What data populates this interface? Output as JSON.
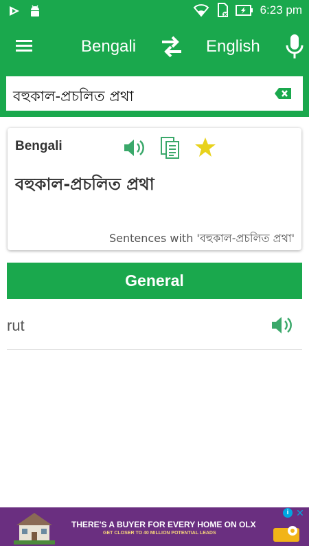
{
  "status_bar": {
    "time": "6:23 pm"
  },
  "app_bar": {
    "source_language": "Bengali",
    "target_language": "English",
    "icons": [
      "hamburger-menu-icon",
      "swap-arrows-icon",
      "microphone-icon"
    ]
  },
  "search": {
    "value": "বহুকাল-প্রচলিত প্রথা",
    "clear_icon": "backspace-clear-icon"
  },
  "card": {
    "language_label": "Bengali",
    "word": "বহুকাল-প্রচলিত প্রথা",
    "sentences_link": "Sentences with 'বহুকাল-প্রচলিত প্রথা'",
    "icons": [
      "speaker-icon",
      "copy-icon",
      "star-icon"
    ]
  },
  "results": {
    "section_title": "General",
    "items": [
      {
        "word": "rut"
      }
    ]
  },
  "ad": {
    "headline": "THERE'S A BUYER FOR EVERY HOME ON OLX",
    "subtext": "GET CLOSER TO 40 MILLION POTENTIAL LEADS",
    "info_label": "i",
    "close_label": "✕"
  },
  "colors": {
    "primary": "#1aa84d",
    "icon_green": "#3aa86a",
    "star_yellow": "#e8d21c",
    "ad_bg": "#6a2f80"
  }
}
